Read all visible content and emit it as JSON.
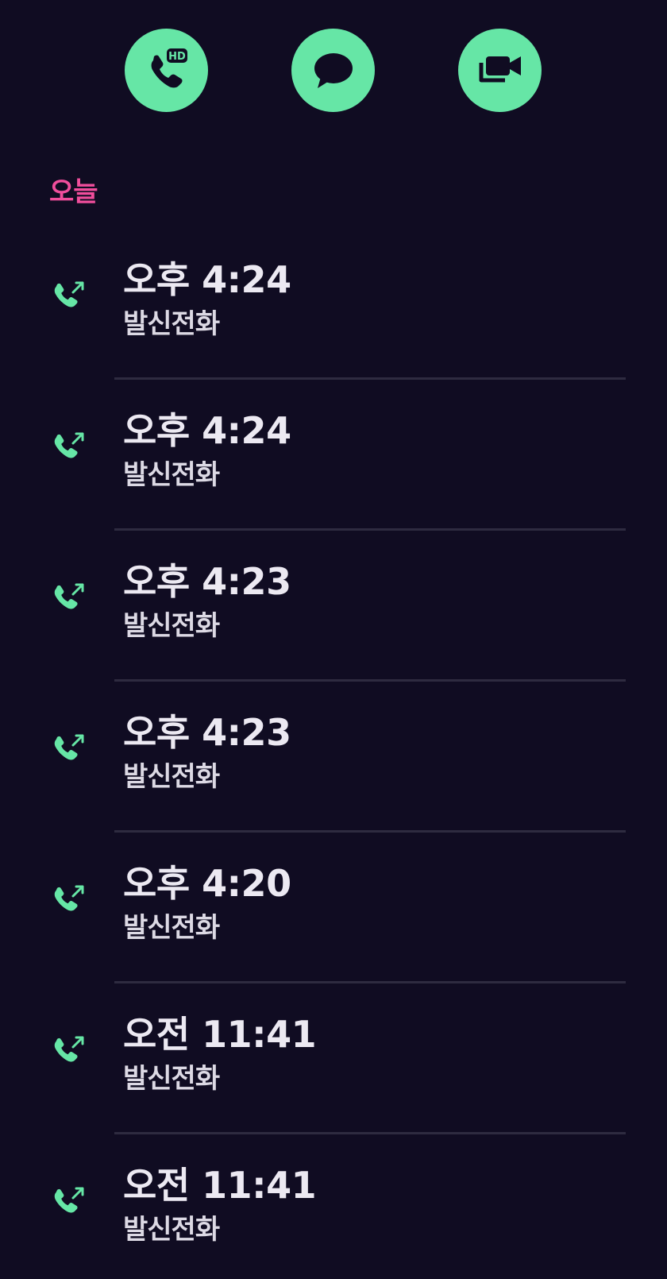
{
  "actions": [
    {
      "name": "hd-voice-call",
      "icon": "phone-hd-icon",
      "badge": "HD"
    },
    {
      "name": "message",
      "icon": "chat-bubble-icon"
    },
    {
      "name": "video-call",
      "icon": "video-camera-icon"
    }
  ],
  "colors": {
    "background": "#100c22",
    "accent": "#66e6a6",
    "section_label": "#f04e9c",
    "text_primary": "#ece9f2",
    "divider": "#2e2b40"
  },
  "section": {
    "label": "오늘"
  },
  "calls": [
    {
      "time": "오후 4:24",
      "type": "발신전화",
      "icon": "outgoing-call-icon"
    },
    {
      "time": "오후 4:24",
      "type": "발신전화",
      "icon": "outgoing-call-icon"
    },
    {
      "time": "오후 4:23",
      "type": "발신전화",
      "icon": "outgoing-call-icon"
    },
    {
      "time": "오후 4:23",
      "type": "발신전화",
      "icon": "outgoing-call-icon"
    },
    {
      "time": "오후 4:20",
      "type": "발신전화",
      "icon": "outgoing-call-icon"
    },
    {
      "time": "오전 11:41",
      "type": "발신전화",
      "icon": "outgoing-call-icon"
    },
    {
      "time": "오전 11:41",
      "type": "발신전화",
      "icon": "outgoing-call-icon"
    }
  ]
}
